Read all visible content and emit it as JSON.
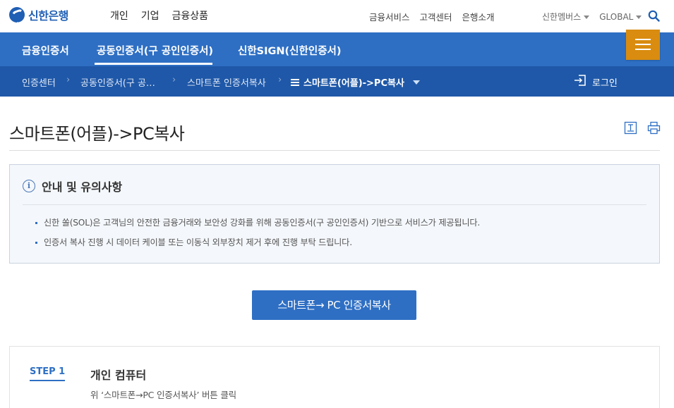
{
  "header": {
    "logo_text": "신한은행",
    "gnb": [
      "개인",
      "기업",
      "금융상품"
    ],
    "util": [
      "금융서비스",
      "고객센터",
      "은행소개"
    ],
    "family_label": "신한멤버스",
    "global_label": "GLOBAL"
  },
  "nav": {
    "tabs": [
      "금융인증서",
      "공동인증서(구 공인인증서)",
      "신한SIGN(신한인증서)"
    ],
    "active_tab": "공동인증서(구 공인인증서)"
  },
  "breadcrumb": {
    "items": [
      "인증센터",
      "공동인증서(구 공…",
      "스마트폰 인증서복사"
    ],
    "current": "스마트폰(어플)->PC복사",
    "login_label": "로그인"
  },
  "page": {
    "title": "스마트폰(어플)->PC복사"
  },
  "notice": {
    "title": "안내 및 유의사항",
    "items": [
      "신한 쏠(SOL)은 고객님의 안전한 금융거래와 보안성 강화를 위해 공동인증서(구 공인인증서) 기반으로 서비스가 제공됩니다.",
      "인증서 복사 진행 시 데이터 케이블 또는 이동식 외부장치 제거 후에 진행 부탁 드립니다."
    ]
  },
  "action": {
    "copy_button": "스마트폰→ PC 인증서복사"
  },
  "step": {
    "label": "STEP 1",
    "title": "개인 컴퓨터",
    "desc": "위 ‘스마트폰→PC 인증서복사’ 버튼 클릭"
  },
  "colors": {
    "nav_blue": "#2e6fc4",
    "breadcrumb_blue": "#1f58a8",
    "menu_orange": "#d98c0f",
    "brand_blue": "#1f5fb4"
  },
  "icons": [
    "search-icon",
    "menu-icon",
    "login-icon",
    "info-icon",
    "download-icon",
    "print-icon"
  ]
}
